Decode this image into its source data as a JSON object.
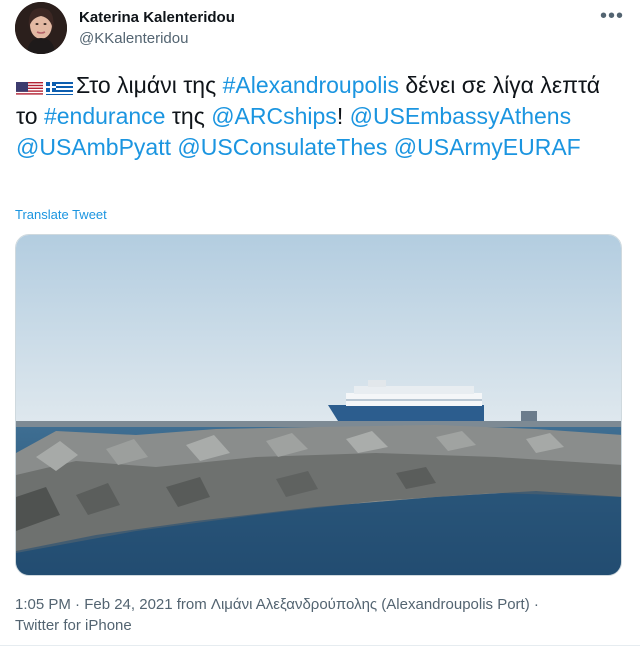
{
  "author": {
    "name": "Katerina Kalenteridou",
    "handle": "@KKalenteridou"
  },
  "more_icon": "more-horizontal-icon",
  "tweet": {
    "flags": [
      "us-flag",
      "greece-flag"
    ],
    "t1": "Στο λιμάνι της ",
    "l1": "#Alexandroupolis",
    "t2": " δένει σε λίγα λεπτά το ",
    "l2": "#endurance",
    "t3": " της ",
    "l3": "@ARCships",
    "t4": "! ",
    "l4": "@USEmbassyAthens",
    "t5": " ",
    "l5": "@USAmbPyatt",
    "t6": " ",
    "l6": "@USConsulateThes",
    "t7": " ",
    "l7": "@USArmyEURAF"
  },
  "translate_label": "Translate Tweet",
  "meta": {
    "line": "1:05 PM · Feb 24, 2021 from Λιμάνι Αλεξανδρούπολης (Alexandroupolis Port) · Twitter for iPhone"
  },
  "colors": {
    "link": "#1b95e0",
    "secondary_text": "#536471",
    "primary_text": "#0f1419"
  }
}
